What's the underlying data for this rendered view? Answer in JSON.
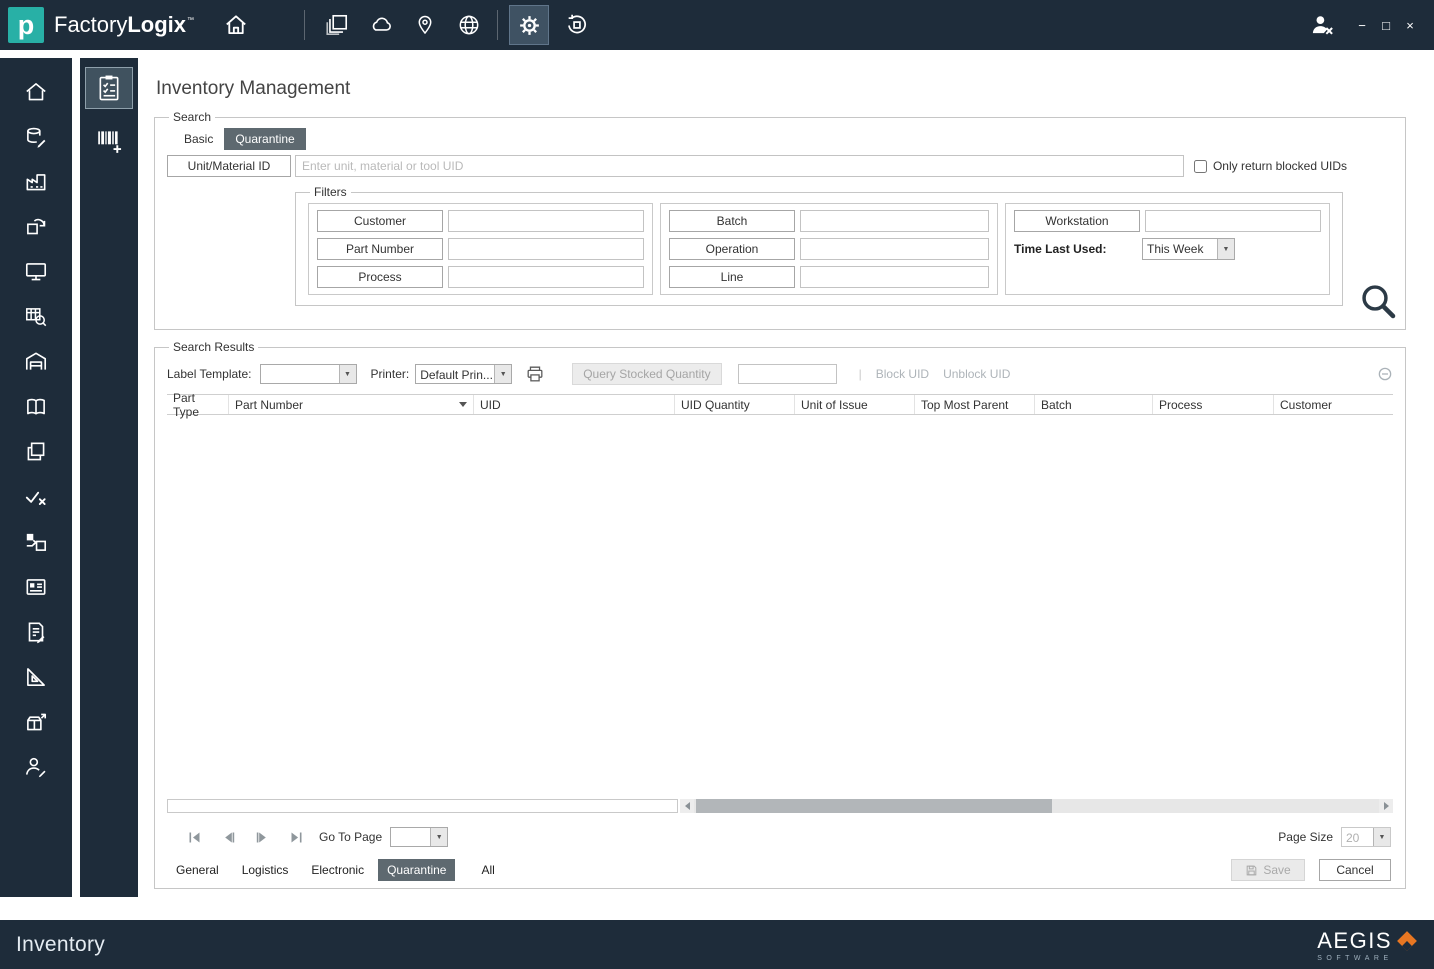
{
  "colors": {
    "navy": "#1e2c3a",
    "teal": "#28b0a6",
    "selected_tab": "#5e6970",
    "orange": "#e87722"
  },
  "icons": {
    "dropdown": "▼"
  },
  "topbar": {
    "logo_letter": "p",
    "brand_factory": "Factory",
    "brand_logix": "Logix",
    "brand_tm": "™",
    "nav_icons": [
      "home-icon",
      "copy-pages-icon",
      "cloud-icon",
      "location-pin-icon",
      "globe-icon",
      "gear-icon",
      "reset-icon"
    ],
    "user_icon": "user-x-icon",
    "window": {
      "minimize": "−",
      "maximize": "□",
      "close": "×"
    }
  },
  "sidebar": {
    "icons": [
      "home-icon",
      "inventory-icon",
      "production-icon",
      "returns-icon",
      "workstation-icon",
      "grid-search-icon",
      "warehouse-icon",
      "documentation-icon",
      "copy-icon",
      "verification-icon",
      "transfer-icon",
      "records-icon",
      "document-edit-icon",
      "engineering-icon",
      "shipping-icon",
      "support-icon"
    ]
  },
  "subsidebar": {
    "icons": [
      "inventory-operations-icon",
      "add-barcode-icon"
    ],
    "selected": "inventory-operations-icon"
  },
  "page": {
    "title": "Inventory Management"
  },
  "search": {
    "legend": "Search",
    "tabs": [
      {
        "label": "Basic",
        "active": false
      },
      {
        "label": "Quarantine",
        "active": true
      }
    ],
    "unit_button": "Unit/Material ID",
    "unit_placeholder": "Enter unit, material or tool UID",
    "blocked_label": "Only return blocked UIDs",
    "filters": {
      "legend": "Filters",
      "col1": [
        "Customer",
        "Part Number",
        "Process"
      ],
      "col2": [
        "Batch",
        "Operation",
        "Line"
      ],
      "workstation": "Workstation",
      "time_last_used_label": "Time Last Used:",
      "time_last_used_value": "This Week"
    }
  },
  "results": {
    "legend": "Search Results",
    "toolbar": {
      "label_template": "Label Template:",
      "label_template_value": "",
      "printer_label": "Printer:",
      "printer_value": "Default Prin...",
      "query_stocked": "Query Stocked Quantity",
      "quantity_value": "",
      "divider": "|",
      "block_uid": "Block UID",
      "unblock_uid": "Unblock UID"
    },
    "columns": [
      "Part Type",
      "Part Number",
      "UID",
      "UID Quantity",
      "Unit of Issue",
      "Top Most Parent",
      "Batch",
      "Process",
      "Customer"
    ],
    "rows": [],
    "pager": {
      "go_to_page": "Go To Page",
      "go_to_page_value": "",
      "page_size_label": "Page Size",
      "page_size_value": "20"
    },
    "tabs": [
      {
        "label": "General",
        "active": false
      },
      {
        "label": "Logistics",
        "active": false
      },
      {
        "label": "Electronic",
        "active": false
      },
      {
        "label": "Quarantine",
        "active": true
      },
      {
        "label": "All",
        "active": false
      }
    ],
    "save": "Save",
    "cancel": "Cancel"
  },
  "statusbar": {
    "title": "Inventory",
    "brand": "AEGIS",
    "brand_sub": "SOFTWARE"
  }
}
